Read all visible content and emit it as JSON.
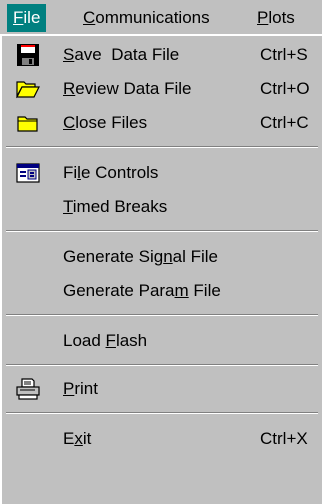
{
  "menubar": {
    "file": {
      "pre": "",
      "key": "F",
      "post": "ile"
    },
    "communications": {
      "pre": "",
      "key": "C",
      "post": "ommunications"
    },
    "plots": {
      "pre": "",
      "key": "P",
      "post": "lots"
    }
  },
  "menu": {
    "save": {
      "pre": "",
      "key": "S",
      "post": "ave  Data File",
      "shortcut": "Ctrl+S",
      "icon": "floppy-disk-icon"
    },
    "review": {
      "pre": "",
      "key": "R",
      "post": "eview Data File",
      "shortcut": "Ctrl+O",
      "icon": "open-folder-icon"
    },
    "close": {
      "pre": "",
      "key": "C",
      "post": "lose Files",
      "shortcut": "Ctrl+C",
      "icon": "closed-folder-icon"
    },
    "file_controls": {
      "pre": "Fi",
      "key": "l",
      "post": "e Controls",
      "icon": "controls-panel-icon"
    },
    "timed_breaks": {
      "pre": "",
      "key": "T",
      "post": "imed Breaks"
    },
    "gen_signal": {
      "pre": "Generate Sig",
      "key": "n",
      "post": "al File"
    },
    "gen_param": {
      "pre": "Generate Para",
      "key": "m",
      "post": " File"
    },
    "load_flash": {
      "pre": "Load ",
      "key": "F",
      "post": "lash"
    },
    "print": {
      "pre": "",
      "key": "P",
      "post": "rint",
      "icon": "printer-icon"
    },
    "exit": {
      "pre": "E",
      "key": "x",
      "post": "it",
      "shortcut": "Ctrl+X"
    }
  }
}
